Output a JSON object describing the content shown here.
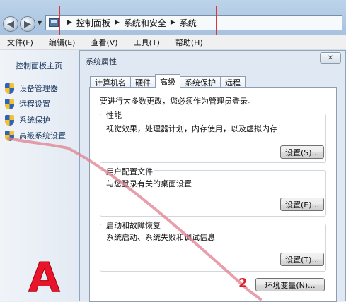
{
  "address_bar": {
    "breadcrumbs": [
      "控制面板",
      "系统和安全",
      "系统"
    ]
  },
  "menu": [
    "文件(F)",
    "编辑(E)",
    "查看(V)",
    "工具(T)",
    "帮助(H)"
  ],
  "left_panel": {
    "home": "控制面板主页",
    "links": [
      "设备管理器",
      "远程设置",
      "系统保护",
      "高级系统设置"
    ]
  },
  "dialog": {
    "title": "系统属性",
    "close": "✕",
    "tabs": [
      "计算机名",
      "硬件",
      "高级",
      "系统保护",
      "远程"
    ],
    "active_tab": "高级",
    "admin_note": "要进行大多数更改，您必须作为管理员登录。",
    "groups": [
      {
        "title": "性能",
        "desc": "视觉效果，处理器计划，内存使用，以及虚拟内存",
        "button": "设置(S)..."
      },
      {
        "title": "用户配置文件",
        "desc": "与您登录有关的桌面设置",
        "button": "设置(E)..."
      },
      {
        "title": "启动和故障恢复",
        "desc": "系统启动、系统失败和调试信息",
        "button": "设置(T)..."
      }
    ],
    "env_button": "环境变量(N)..."
  },
  "annotations": {
    "letter": "A",
    "step": "2"
  },
  "colors": {
    "annotation_red": "#e8152a",
    "link_blue": "#1d3b63"
  },
  "icons": {
    "back": "back-arrow-icon",
    "forward": "forward-arrow-icon",
    "shield": "uac-shield-icon"
  }
}
